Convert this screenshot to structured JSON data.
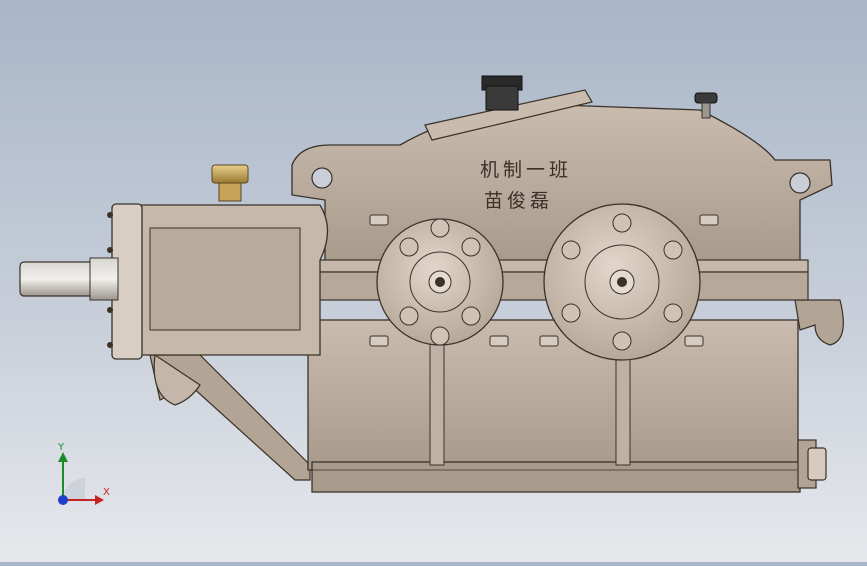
{
  "engraving": {
    "line1": "机制一班",
    "line2": "苗俊磊"
  },
  "triad": {
    "y_label": "Y",
    "x_label": "X"
  },
  "colors": {
    "background_top": "#a9b6c8",
    "background_bottom": "#e6e8ec",
    "housing": "#b8aa9c",
    "housing_dark": "#8e8172",
    "outline": "#3a3128",
    "axis_x": "#c42424",
    "axis_y": "#1a8a2a",
    "axis_z": "#1f3fc8"
  }
}
